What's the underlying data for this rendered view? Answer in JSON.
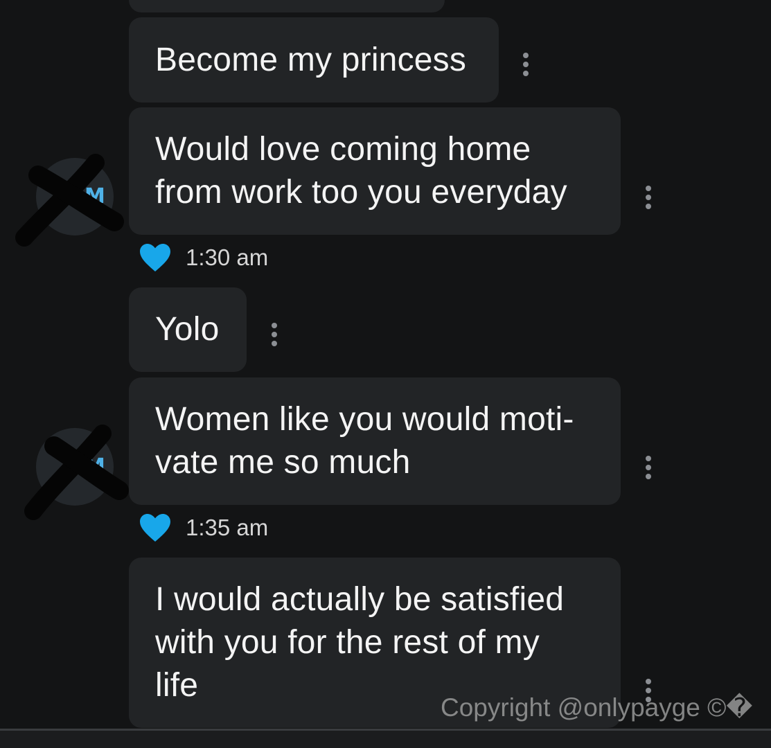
{
  "messages": [
    {
      "text": "Become my princess"
    },
    {
      "lines": [
        "Would love coming home",
        "from work too you everyday"
      ]
    },
    {
      "text": "Yolo"
    },
    {
      "lines": [
        "Women like you would moti-",
        "vate me so much"
      ]
    },
    {
      "lines": [
        "I would actually be satisfied",
        "with you for the rest of my",
        "life"
      ]
    }
  ],
  "timestamps": [
    "1:30 am",
    "1:35 am"
  ],
  "avatar_initial": "M",
  "watermark": "Copyright @onlypayge ©�",
  "icons": {
    "reaction": "heart-icon",
    "menu": "more-vertical-icon"
  },
  "colors": {
    "background": "#131415",
    "bubble": "#222426",
    "heart": "#18a7ea",
    "avatar_initial": "#4fb2e8",
    "scribble": "#050505"
  }
}
